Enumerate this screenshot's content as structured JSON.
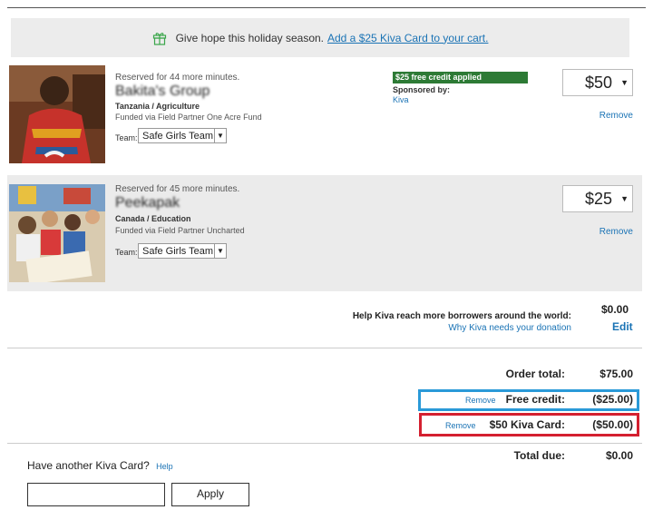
{
  "promo": {
    "text": "Give hope this holiday season.",
    "link": "Add a $25 Kiva Card to your cart."
  },
  "loans": [
    {
      "reserved": "Reserved for 44 more minutes.",
      "name_blurred": "Bakita's",
      "name_clear": "Group",
      "location": "Tanzania / Agriculture",
      "funded": "Funded via Field Partner One Acre Fund",
      "team_label": "Team:",
      "team": "Safe Girls Team",
      "credit_badge": "$25 free credit applied",
      "sponsored_label": "Sponsored by:",
      "sponsor": "Kiva",
      "amount": "$50",
      "remove": "Remove"
    },
    {
      "reserved": "Reserved for 45 more minutes.",
      "name_blurred": "Peekapak",
      "name_clear": "",
      "location": "Canada / Education",
      "funded": "Funded via Field Partner Uncharted",
      "team_label": "Team:",
      "team": "Safe Girls Team",
      "amount": "$25",
      "remove": "Remove"
    }
  ],
  "donation": {
    "text": "Help Kiva reach more borrowers around the world:",
    "why_link": "Why Kiva needs your donation",
    "amount": "$0.00",
    "edit": "Edit"
  },
  "summary": {
    "order_total_label": "Order total:",
    "order_total": "$75.00",
    "free_credit_remove": "Remove",
    "free_credit_label": "Free credit:",
    "free_credit": "($25.00)",
    "kiva_card_remove": "Remove",
    "kiva_card_label": "$50 Kiva Card:",
    "kiva_card": "($50.00)",
    "total_due_label": "Total due:",
    "total_due": "$0.00"
  },
  "kiva_card": {
    "title": "Have another Kiva Card?",
    "help": "Help",
    "input_value": "",
    "apply": "Apply"
  },
  "colors": {
    "link": "#1a73b5",
    "credit_badge": "#2d7a35",
    "highlight_blue": "#2a9ad8",
    "highlight_red": "#d42030"
  }
}
